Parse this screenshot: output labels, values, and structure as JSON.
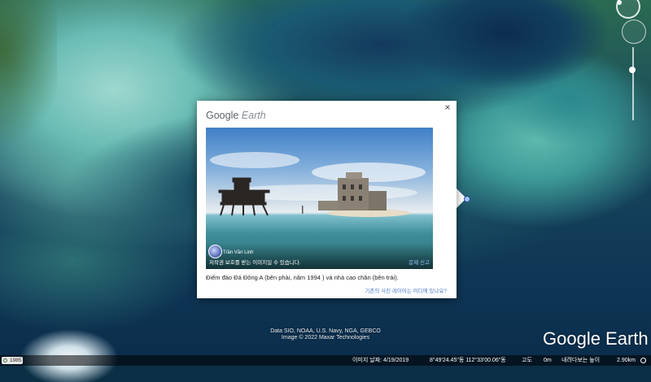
{
  "popup": {
    "logo_main": "Google",
    "logo_sub": "Earth",
    "close_symbol": "×",
    "photo": {
      "author_name": "Trần Văn Linh",
      "copyright_notice": "저작권 보호를 받는 이미지일 수 있습니다.",
      "report_link": "문제 신고"
    },
    "caption": "Điểm đảo Đá Đông A (bên phải, năm 1994 ) và nhà cao chân (bên trái).",
    "layer_link": "기존의 사진 레이어는 어디에 있나요?"
  },
  "attribution": {
    "line1": "Data SIO, NOAA, U.S. Navy, NGA, GEBCO",
    "line2": "Image © 2022 Maxar Technologies"
  },
  "brand": "Google Earth",
  "statusbar": {
    "year": "1985",
    "imagery_date_label": "이미지 날짜: 4/19/2019",
    "coordinates": "8°49'24.45\"동 112°33'00.06\"동",
    "elevation_label": "고도",
    "elevation_value": "0m",
    "eye_alt_label": "내려다보는 높이",
    "eye_alt_value": "2.90km"
  },
  "icons": {
    "compass": "compass-icon",
    "close": "close-icon",
    "globe": "globe-icon",
    "clock": "clock-icon"
  }
}
